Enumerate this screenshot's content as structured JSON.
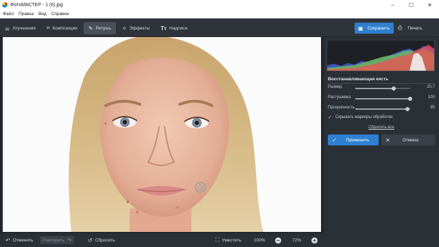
{
  "window": {
    "title": "ФотоМАСТЕР - 1 (6).jpg",
    "controls": [
      "–",
      "☐",
      "✕"
    ]
  },
  "menu": [
    "Файл",
    "Правка",
    "Вид",
    "Справка"
  ],
  "tabs": [
    {
      "label": "Улучшения",
      "icon": "sliders-icon"
    },
    {
      "label": "Композиция",
      "icon": "crop-icon"
    },
    {
      "label": "Ретушь",
      "icon": "brush-icon",
      "active": true
    },
    {
      "label": "Эффекты",
      "icon": "magic-wand-icon"
    },
    {
      "label": "Надписи",
      "icon": "text-icon"
    }
  ],
  "toolbar": {
    "save_label": "Сохранить",
    "print_label": "Печать"
  },
  "panel": {
    "title": "Восстанавливающая кисть",
    "sliders": [
      {
        "label": "Размер",
        "value": "20,7",
        "fraction": 0.7
      },
      {
        "label": "Растушевка",
        "value": "100",
        "fraction": 1.0
      },
      {
        "label": "Прозрачность",
        "value": "95",
        "fraction": 0.95
      }
    ],
    "checkbox_label": "Скрывать маркеры обработки",
    "checkbox_checked": true,
    "reset_all": "Сбросить все",
    "apply_label": "Применить",
    "cancel_label": "Отмена"
  },
  "bottom": {
    "undo_label": "Отменить",
    "redo_label": "Повторить",
    "reset_label": "Сбросить",
    "fit_label": "Уместить",
    "zoom_100": "100%",
    "zoom_current": "72%"
  },
  "colors": {
    "accent": "#2f7fd0",
    "panel_bg": "#2b3036",
    "toolbar_bg": "#2f343a"
  }
}
